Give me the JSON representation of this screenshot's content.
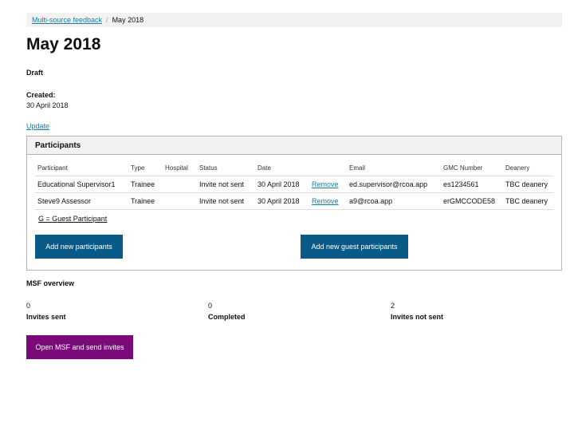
{
  "breadcrumb": {
    "parent": "Multi-source feedback",
    "current": "May 2018"
  },
  "page": {
    "title": "May 2018",
    "status": "Draft",
    "created_label": "Created:",
    "created_value": "30 April 2018",
    "update_link": "Update"
  },
  "participants": {
    "heading": "Participants",
    "columns": [
      "Participant",
      "Type",
      "Hospital",
      "Status",
      "Date",
      "",
      "Email",
      "GMC Number",
      "Deanery"
    ],
    "rows": [
      {
        "participant": "Educational Supervisor1",
        "type": "Trainee",
        "hospital": "",
        "status": "Invite not sent",
        "date": "30 April 2018",
        "action": "Remove",
        "email": "ed.supervisor@rcoa.app",
        "gmc": "es1234561",
        "deanery": "TBC deanery"
      },
      {
        "participant": "Steve9 Assessor",
        "type": "Trainee",
        "hospital": "",
        "status": "Invite not sent",
        "date": "30 April 2018",
        "action": "Remove",
        "email": "a9@rcoa.app",
        "gmc": "erGMCCODE58",
        "deanery": "TBC deanery"
      }
    ],
    "guest_legend": "G = Guest Participant",
    "add_button": "Add new participants",
    "add_guest_button": "Add new guest participants"
  },
  "overview": {
    "title": "MSF overview",
    "stats": [
      {
        "value": "0",
        "label": "Invites sent"
      },
      {
        "value": "0",
        "label": "Completed"
      },
      {
        "value": "2",
        "label": "Invites not sent"
      }
    ],
    "open_button": "Open MSF and send invites"
  },
  "colors": {
    "link": "#1a7fa6",
    "primary_button": "#0a5a87",
    "accent_button": "#7a0a7a",
    "panel_header": "#f2f2f2"
  }
}
